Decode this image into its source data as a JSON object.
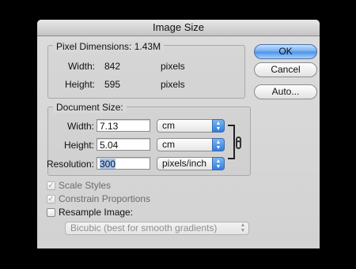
{
  "window": {
    "title": "Image Size"
  },
  "pixel_dimensions": {
    "label": "Pixel Dimensions:",
    "size": "1.43M",
    "width_label": "Width:",
    "width_value": "842",
    "width_unit": "pixels",
    "height_label": "Height:",
    "height_value": "595",
    "height_unit": "pixels"
  },
  "document_size": {
    "label": "Document Size:",
    "width_label": "Width:",
    "width_value": "7.13",
    "width_unit": "cm",
    "height_label": "Height:",
    "height_value": "5.04",
    "height_unit": "cm",
    "resolution_label": "Resolution:",
    "resolution_value": "300",
    "resolution_unit": "pixels/inch"
  },
  "buttons": {
    "ok": "OK",
    "cancel": "Cancel",
    "auto": "Auto..."
  },
  "options": {
    "scale_styles": {
      "label": "Scale Styles",
      "checked": true,
      "enabled": false
    },
    "constrain_proportions": {
      "label": "Constrain Proportions",
      "checked": true,
      "enabled": false
    },
    "resample_image": {
      "label": "Resample Image:",
      "checked": false,
      "enabled": true
    },
    "resample_method": "Bicubic (best for smooth gradients)"
  },
  "icons": {
    "check": "checkmark-icon",
    "link": "chain-link-icon",
    "arrows": "up-down-arrows-icon"
  },
  "colors": {
    "default_button": "#4b90e8",
    "selection": "#a7c7f2",
    "background": "#000000"
  }
}
